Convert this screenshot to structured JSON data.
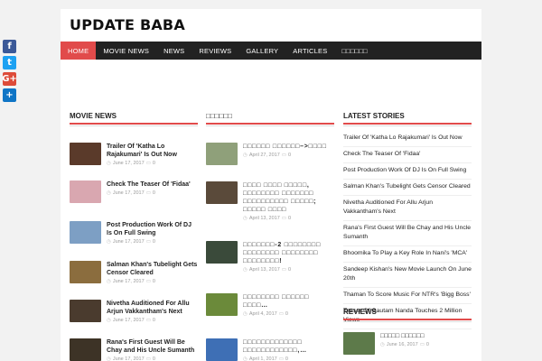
{
  "share": [
    {
      "icon": "facebook-icon",
      "glyph": "f",
      "color": "#3b5998"
    },
    {
      "icon": "twitter-icon",
      "glyph": "t",
      "color": "#1da1f2"
    },
    {
      "icon": "google-plus-icon",
      "glyph": "G+",
      "color": "#dd4b39"
    },
    {
      "icon": "share-icon",
      "glyph": "+",
      "color": "#0f75c6"
    }
  ],
  "site": {
    "title": "UPDATE BABA"
  },
  "nav": {
    "items": [
      {
        "label": "HOME",
        "active": true
      },
      {
        "label": "MOVIE NEWS"
      },
      {
        "label": "NEWS"
      },
      {
        "label": "REVIEWS"
      },
      {
        "label": "GALLERY"
      },
      {
        "label": "ARTICLES"
      },
      {
        "label": "□□□□□□"
      }
    ]
  },
  "accent": "#e14b4b",
  "movie_news": {
    "heading": "MOVIE NEWS",
    "posts": [
      {
        "title": "Trailer Of 'Katha Lo Rajakumari' Is Out Now",
        "date": "June 17, 2017",
        "comments": "0",
        "thumb": "#5a3a2a"
      },
      {
        "title": "Check The Teaser Of 'Fidaa'",
        "date": "June 17, 2017",
        "comments": "0",
        "thumb": "#d9a7b0"
      },
      {
        "title": "Post Production Work Of DJ Is On Full Swing",
        "date": "June 17, 2017",
        "comments": "0",
        "thumb": "#7d9fc4"
      },
      {
        "title": "Salman Khan's Tubelight Gets Censor Cleared",
        "date": "June 17, 2017",
        "comments": "0",
        "thumb": "#8b6d3e"
      },
      {
        "title": "Nivetha Auditioned For Allu Arjun Vakkantham's Next",
        "date": "June 17, 2017",
        "comments": "0",
        "thumb": "#4a3b2e"
      },
      {
        "title": "Rana's First Guest Will Be Chay and His Uncle Sumanth",
        "date": "June 17, 2017",
        "comments": "0",
        "thumb": "#3d3326"
      }
    ]
  },
  "telugu": {
    "heading": "□□□□□□",
    "posts": [
      {
        "title": "□□□□□□ □□□□□□–>□□□□",
        "date": "April 27, 2017",
        "comments": "0",
        "thumb": "#8fa07a"
      },
      {
        "title": "□□□□ □□□□ □□□□□, □□□□□□□□ □□□□□□□ □□□□□□□□□□ □□□□□; □□□□□ □□□□",
        "date": "April 13, 2017",
        "comments": "0",
        "thumb": "#5a4a3a"
      },
      {
        "title": "□□□□□□□-2 □□□□□□□□ □□□□□□□□ □□□□□□□□ □□□□□□□□!",
        "date": "April 13, 2017",
        "comments": "0",
        "thumb": "#3a4a3a"
      },
      {
        "title": "□□□□□□□□ □□□□□□ □□□□…",
        "date": "April 4, 2017",
        "comments": "0",
        "thumb": "#6b8a3a"
      },
      {
        "title": "□□□□□□□□□□□□□ □□□□□□□□□□□□,…",
        "date": "April 1, 2017",
        "comments": "0",
        "thumb": "#3e6fb5"
      }
    ]
  },
  "latest": {
    "heading": "LATEST STORIES",
    "items": [
      "Trailer Of 'Katha Lo Rajakumari' Is Out Now",
      "Check The Teaser Of 'Fidaa'",
      "Post Production Work Of DJ Is On Full Swing",
      "Salman Khan's Tubelight Gets Censor Cleared",
      "Nivetha Auditioned For Allu Arjun Vakkantham's Next",
      "Rana's First Guest Will Be Chay and His Uncle Sumanth",
      "Bhoomika To Play a Key Role In Nani's 'MCA'",
      "Sandeep Kishan's New Movie Launch On June 20th",
      "Thaman To Score Music For NTR's 'Bigg Boss'",
      "Teaser Of Gautam Nanda Touches 2 Million Views"
    ]
  },
  "reviews": {
    "heading": "REVIEWS",
    "post": {
      "title": "□□□□□ □□□□□□",
      "date": "June 16, 2017",
      "comments": "0",
      "thumb": "#5d7a4a"
    }
  }
}
